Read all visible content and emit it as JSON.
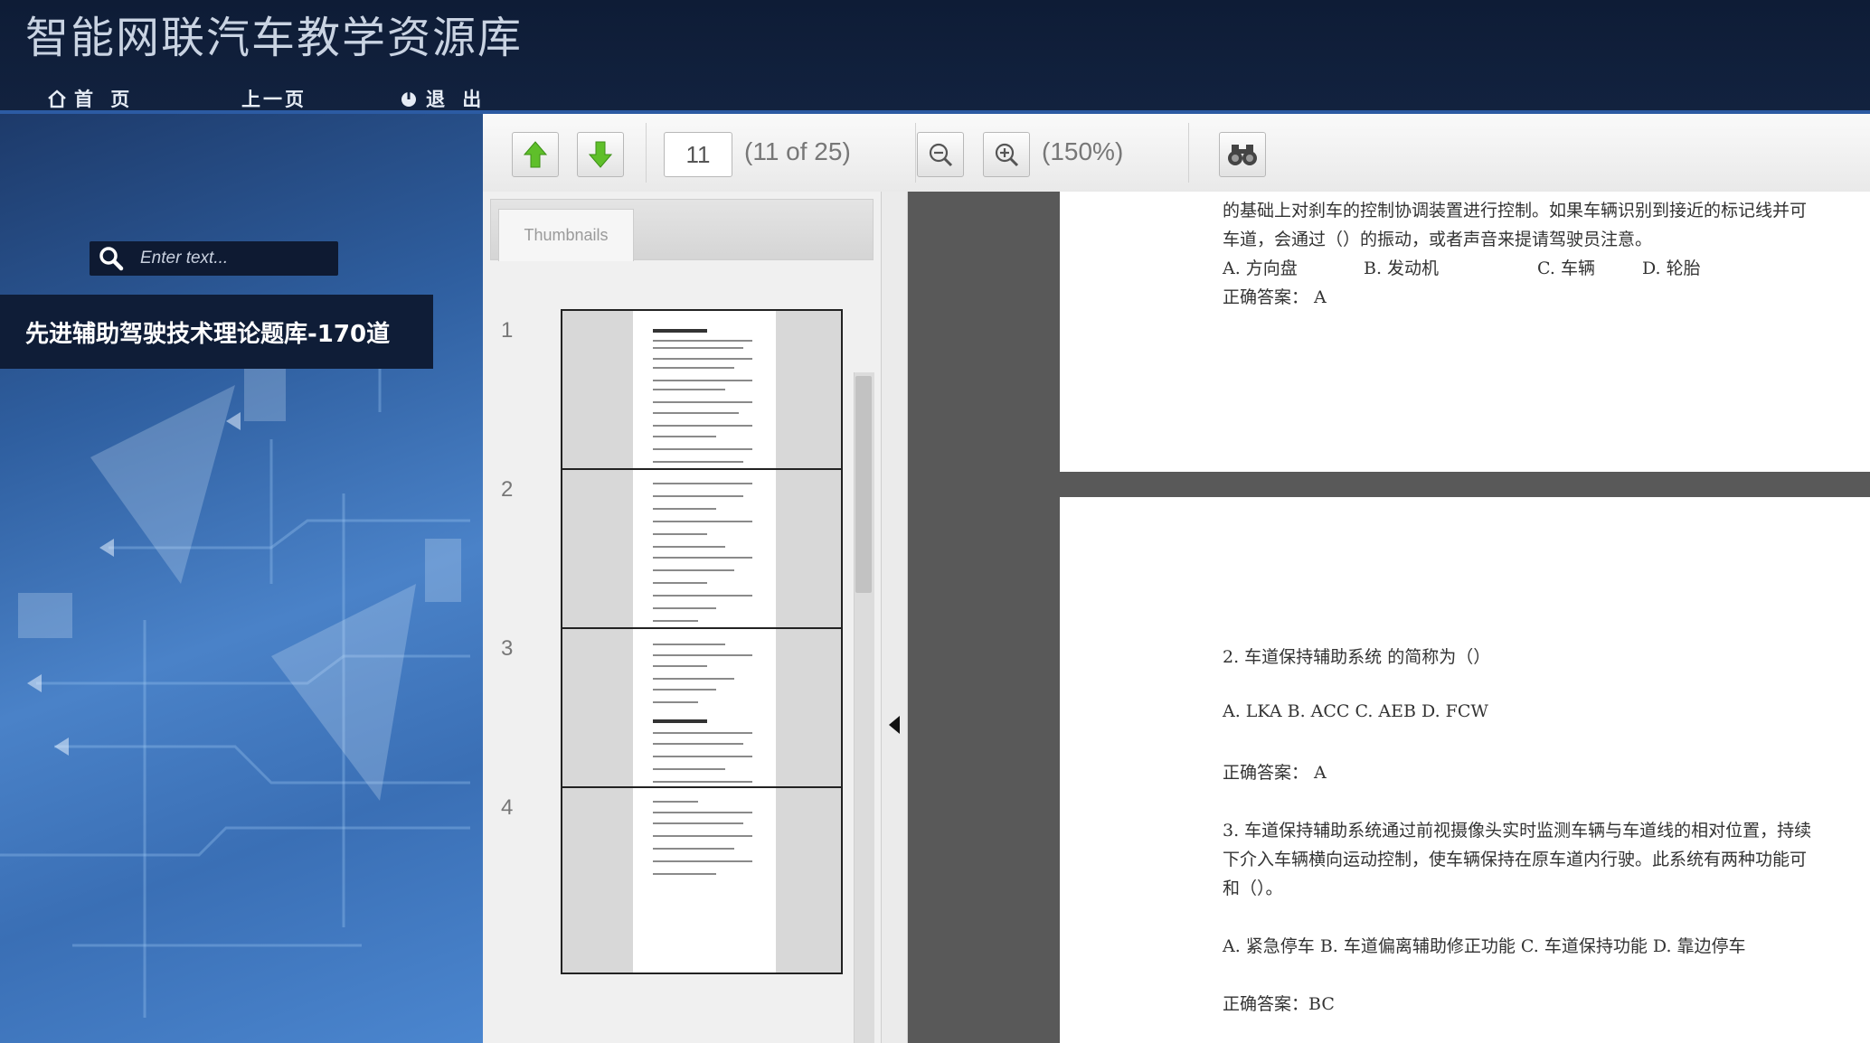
{
  "app": {
    "title": "智能网联汽车教学资源库"
  },
  "nav": [
    {
      "label": "首 页",
      "icon": "home-icon"
    },
    {
      "label": "上一页",
      "icon": ""
    },
    {
      "label": "退 出",
      "icon": "power-icon"
    }
  ],
  "search": {
    "placeholder": "Enter text..."
  },
  "document": {
    "title": "先进辅助驾驶技术理论题库-170道"
  },
  "toolbar": {
    "page_value": "11",
    "page_info": "(11 of 25)",
    "zoom": "(150%)"
  },
  "thumbnails": {
    "tab_label": "Thumbnails",
    "pages": [
      "1",
      "2",
      "3",
      "4"
    ]
  },
  "content": {
    "page1": {
      "line1": "的基础上对刹车的控制协调装置进行控制。如果车辆识别到接近的标记线并可",
      "line2": "车道，会通过（）的振动，或者声音来提请驾驶员注意。",
      "options": [
        "A. 方向盘",
        "B. 发动机",
        "C. 车辆",
        "D. 轮胎"
      ],
      "answer": "正确答案：  A"
    },
    "page2": {
      "q2": "2.  车道保持辅助系统  的简称为（）",
      "q2_options": "A.  LKA  B.  ACC  C.  AEB  D.  FCW",
      "q2_answer": "正确答案：  A",
      "q3_line1": "3. 车道保持辅助系统通过前视摄像头实时监测车辆与车道线的相对位置，持续",
      "q3_line2": "下介入车辆横向运动控制，使车辆保持在原车道内行驶。此系统有两种功能可",
      "q3_line3": "和（）。",
      "q3_options": "A. 紧急停车  B. 车道偏离辅助修正功能  C. 车道保持功能  D. 靠边停车",
      "q3_answer": "正确答案：BC"
    }
  }
}
